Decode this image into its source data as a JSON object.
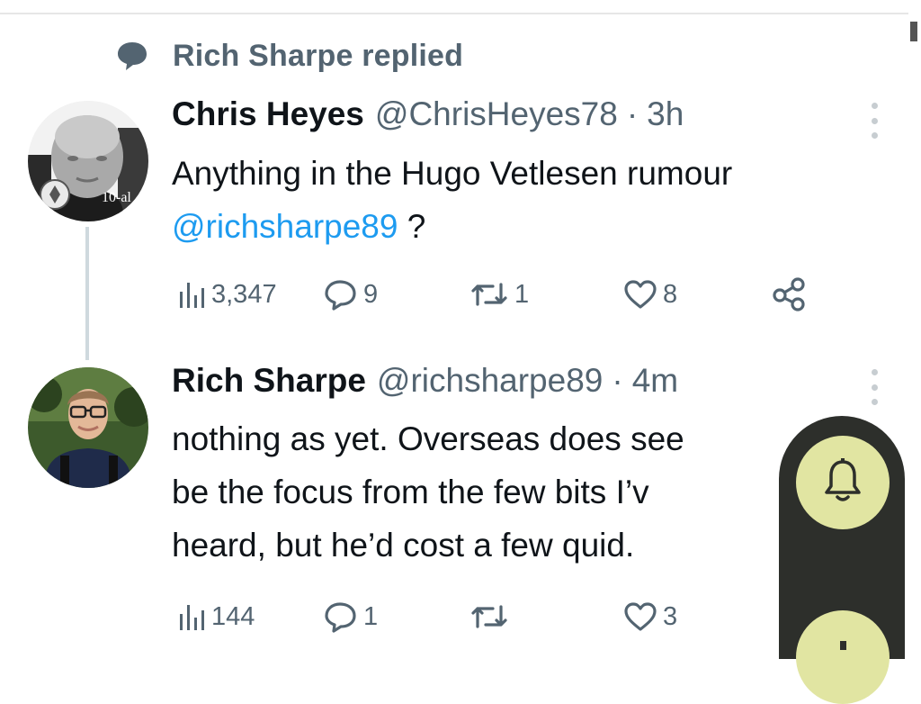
{
  "social_context": {
    "text": "Rich Sharpe replied",
    "icon": "speech-bubble-icon"
  },
  "tweets": [
    {
      "name": "Chris Heyes",
      "handle": "@ChrisHeyes78",
      "separator": "·",
      "time": "3h",
      "text_line1": "Anything in the Hugo Vetlesen rumour",
      "mention": "@richsharpe89",
      "text_after_mention": " ?",
      "avatar_badge": "10-al",
      "stats": {
        "views": "3,347",
        "replies": "9",
        "retweets": "1",
        "likes": "8"
      }
    },
    {
      "name": "Rich Sharpe",
      "handle": "@richsharpe89",
      "separator": "·",
      "time": "4m",
      "lines": [
        "nothing as yet. Overseas does see",
        "be the focus from the few bits I’v",
        "heard, but he’d cost a few quid."
      ],
      "stats": {
        "views": "144",
        "replies": "1",
        "retweets": "",
        "likes": "3"
      }
    }
  ],
  "overlay": {
    "bell_icon": "bell-icon"
  },
  "colors": {
    "mention": "#1d9bf0",
    "muted": "#536471",
    "thread_line": "#cfd9de",
    "fab": "#e1e5a2",
    "overlay": "#2d2f2b"
  }
}
